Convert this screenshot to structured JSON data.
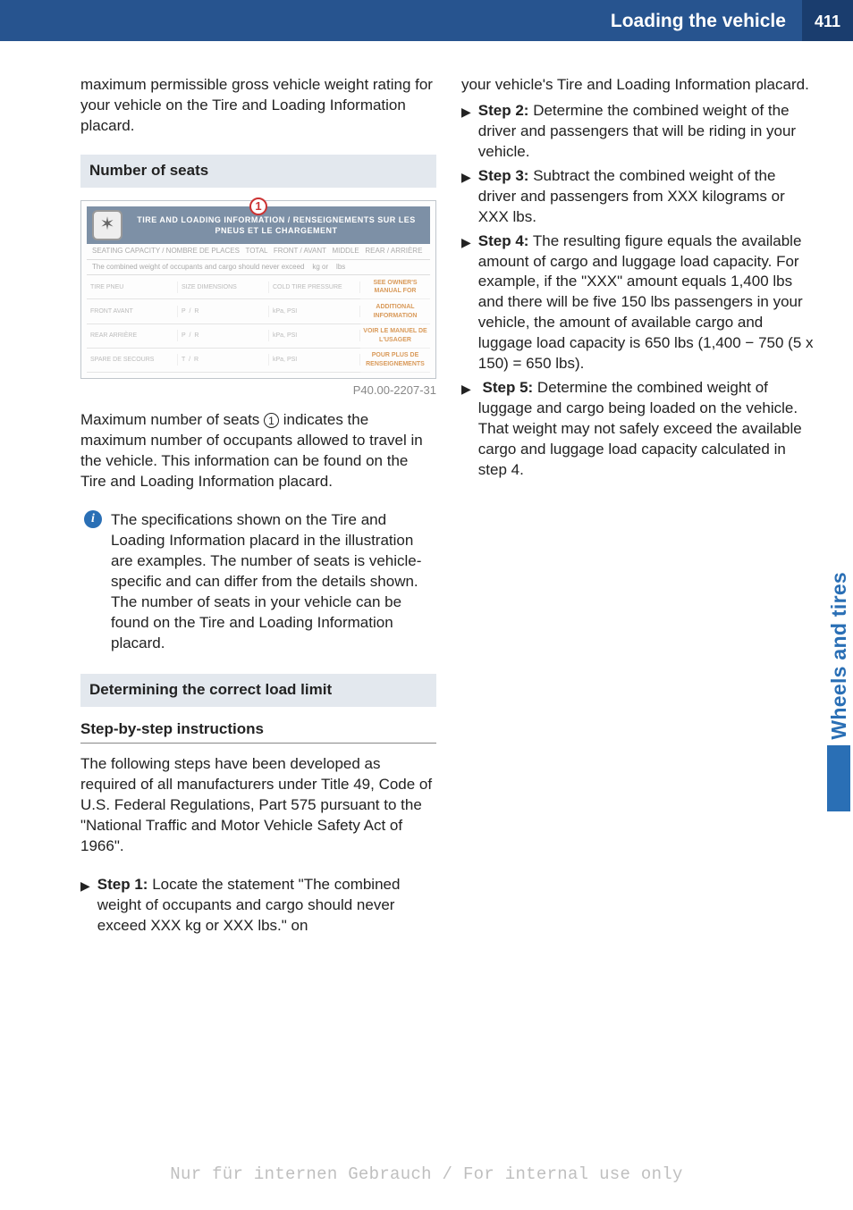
{
  "header": {
    "title": "Loading the vehicle",
    "page": "411"
  },
  "side_tab": "Wheels and tires",
  "left": {
    "intro": "maximum permissible gross vehicle weight rating for your vehicle on the Tire and Loading Information placard.",
    "section_seats": "Number of seats",
    "figure": {
      "header_line": "TIRE AND LOADING INFORMATION / RENSEIGNEMENTS SUR LES PNEUS ET LE CHARGEMENT",
      "caption": "P40.00-2207-31",
      "circle": "1",
      "side_labels": [
        "SEE OWNER'S MANUAL FOR",
        "ADDITIONAL INFORMATION",
        "VOIR LE MANUEL DE L'USAGER",
        "POUR PLUS DE RENSEIGNEMENTS"
      ]
    },
    "seats_para_a": "Maximum number of seats ",
    "seats_para_b": " indicates the maximum number of occupants allowed to travel in the vehicle. This information can be found on the Tire and Loading Information placard.",
    "circle_inline": "1",
    "info_note": "The specifications shown on the Tire and Loading Information placard in the illustration are examples. The number of seats is vehicle-specific and can differ from the details shown. The number of seats in your vehicle can be found on the Tire and Loading Information placard.",
    "section_load": "Determining the correct load limit",
    "sub_steps": "Step-by-step instructions",
    "steps_intro": "The following steps have been developed as required of all manufacturers under Title 49, Code of U.S. Federal Regulations, Part 575 pursuant to the \"National Traffic and Motor Vehicle Safety Act of 1966\".",
    "step1_label": "Step 1:",
    "step1_text": " Locate the statement \"The combined weight of occupants and cargo should never exceed XXX kg or XXX lbs.\" on"
  },
  "right": {
    "cont": "your vehicle's Tire and Loading Information placard.",
    "step2_label": "Step 2:",
    "step2_text": " Determine the combined weight of the driver and passengers that will be riding in your vehicle.",
    "step3_label": "Step 3:",
    "step3_text": " Subtract the combined weight of the driver and passengers from XXX kilograms or XXX lbs.",
    "step4_label": "Step 4:",
    "step4_text": " The resulting figure equals the available amount of cargo and luggage load capacity. For example, if the \"XXX\" amount equals 1,400 lbs and there will be five 150 lbs passengers in your vehicle, the amount of available cargo and luggage load capacity is 650 lbs (1,400 − 750 (5 x 150) = 650 lbs).",
    "step5_label": "Step 5:",
    "step5_text": " Determine the combined weight of luggage and cargo being loaded on the vehicle. That weight may not safely exceed the available cargo and luggage load capacity calculated in step 4."
  },
  "footer": "Nur für internen Gebrauch / For internal use only"
}
